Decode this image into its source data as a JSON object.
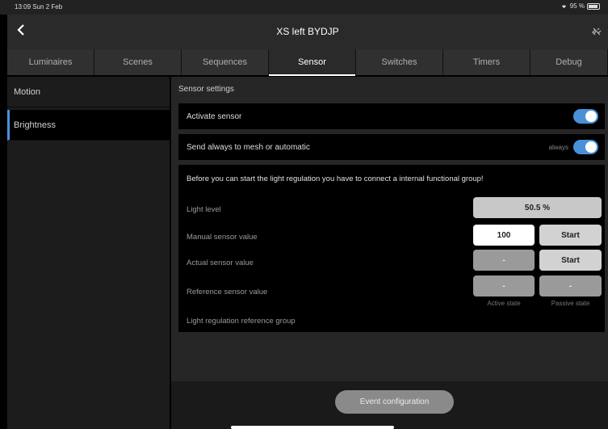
{
  "status": {
    "time": "13:09  Sun 2 Feb",
    "battery": "95 %"
  },
  "header": {
    "back_icon": "chevron-left-icon",
    "title": "XS left BYDJP",
    "link_icon": "link-off-icon"
  },
  "tabs": [
    {
      "label": "Luminaires"
    },
    {
      "label": "Scenes"
    },
    {
      "label": "Sequences"
    },
    {
      "label": "Sensor",
      "active": true
    },
    {
      "label": "Switches"
    },
    {
      "label": "Timers"
    },
    {
      "label": "Debug"
    }
  ],
  "sidebar": {
    "items": [
      {
        "label": "Motion"
      },
      {
        "label": "Brightness",
        "active": true
      }
    ]
  },
  "main": {
    "section_title": "Sensor settings",
    "activate_sensor": {
      "label": "Activate sensor",
      "on": true
    },
    "send_mesh": {
      "label": "Send always to mesh or automatic",
      "caption": "always",
      "on": true
    },
    "warning": "Before you can start the light regulation you have to connect a internal functional group!",
    "light_level": {
      "label": "Light level",
      "value": "50.5 %"
    },
    "manual_sensor": {
      "label": "Manual sensor value",
      "value": "100",
      "button": "Start"
    },
    "actual_sensor": {
      "label": "Actual sensor value",
      "value": "-",
      "button": "Start"
    },
    "reference_sensor": {
      "label": "Reference sensor value",
      "active_value": "-",
      "passive_value": "-",
      "active_caption": "Active state",
      "passive_caption": "Passive state"
    },
    "reference_group": {
      "label": "Light regulation reference group"
    }
  },
  "footer": {
    "event_button": "Event configuration"
  },
  "colors": {
    "accent": "#4a90d9",
    "background": "#000000",
    "panel": "#262626"
  }
}
